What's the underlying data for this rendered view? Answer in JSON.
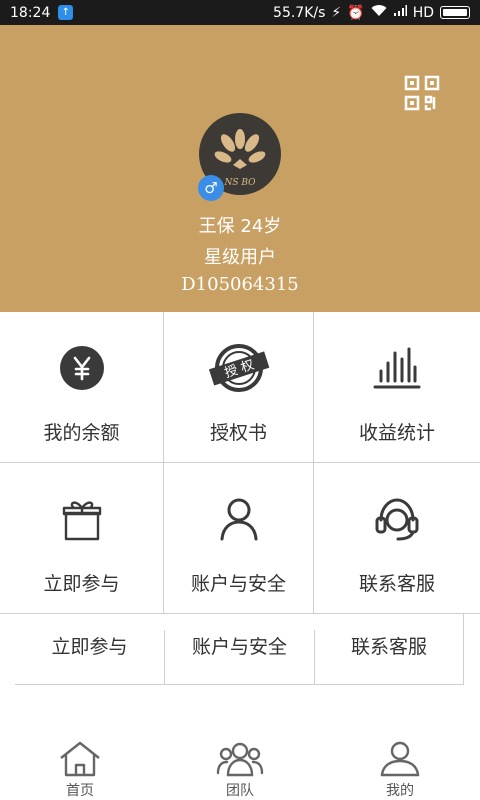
{
  "status_bar": {
    "time": "18:24",
    "speed": "55.7K/s",
    "network": "HD"
  },
  "profile": {
    "name_age": "王保 24岁",
    "level": "星级用户",
    "user_id": "D105064315",
    "gender_symbol": "♂",
    "avatar_text": "NS BO"
  },
  "grid": {
    "row1": [
      {
        "label": "我的余额",
        "icon": "yuan-coin-icon"
      },
      {
        "label": "授权书",
        "icon": "authorization-stamp-icon",
        "stamp_text": "授 权"
      },
      {
        "label": "收益统计",
        "icon": "bar-chart-icon"
      }
    ],
    "row2": [
      {
        "label": "立即参与",
        "icon": "gift-icon"
      },
      {
        "label": "账户与安全",
        "icon": "user-icon"
      },
      {
        "label": "联系客服",
        "icon": "headset-icon"
      }
    ],
    "row3": [
      {
        "label": "立即参与"
      },
      {
        "label": "账户与安全"
      },
      {
        "label": "联系客服"
      }
    ]
  },
  "tabbar": [
    {
      "label": "首页",
      "icon": "home-icon"
    },
    {
      "label": "团队",
      "icon": "team-icon"
    },
    {
      "label": "我的",
      "icon": "profile-icon"
    }
  ],
  "colors": {
    "header": "#c9a063",
    "badge": "#3a8ee6",
    "icon": "#3a3a3a"
  }
}
